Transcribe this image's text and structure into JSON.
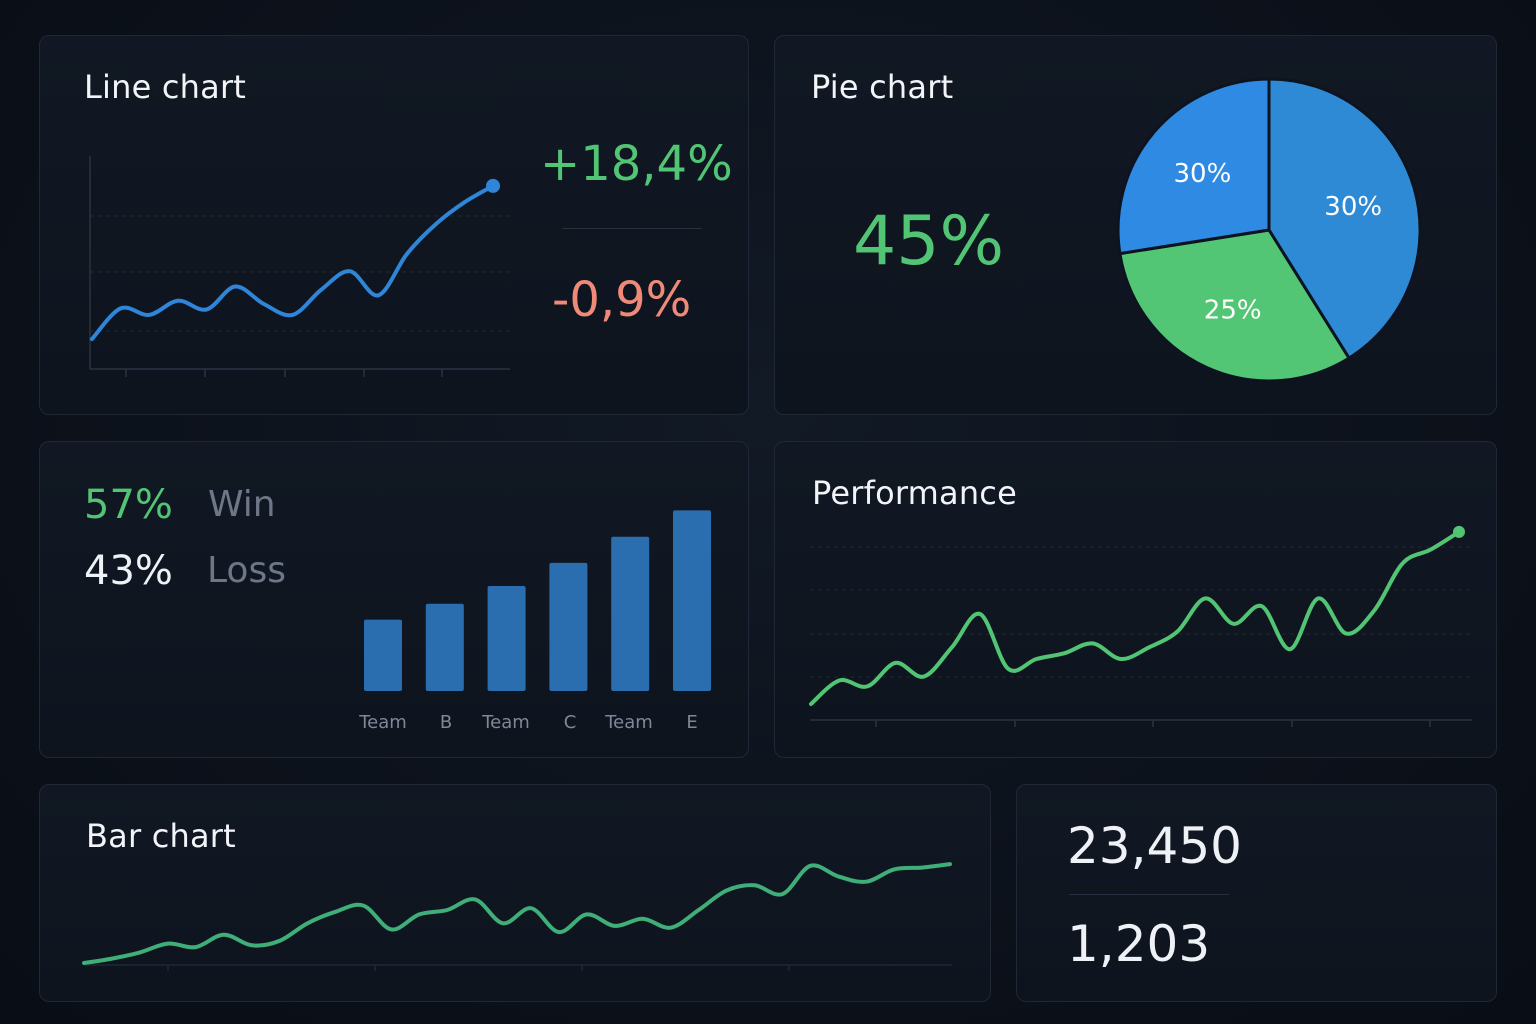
{
  "colors": {
    "blue": "#2f86d8",
    "green": "#52c575",
    "red": "#f08a78",
    "bar": "#2a6eb0",
    "pie_blue_a": "#2e8ae3",
    "pie_blue_b": "#2f8ad6",
    "pie_green": "#52c675"
  },
  "line_card": {
    "title": "Line chart",
    "up_value": "+18,4%",
    "down_value": "-0,9%"
  },
  "pie_card": {
    "title": "Pie chart",
    "big_value": "45%"
  },
  "winloss_card": {
    "win_value": "57%",
    "win_label": "Win",
    "loss_value": "43%",
    "loss_label": "Loss"
  },
  "performance_card": {
    "title": "Performance"
  },
  "bar_card": {
    "title": "Bar chart"
  },
  "stats_card": {
    "primary": "23,450",
    "secondary": "1,203"
  },
  "chart_data": [
    {
      "type": "line",
      "y": [
        0,
        28,
        22,
        35,
        27,
        48,
        32,
        22,
        45,
        62,
        40,
        78,
        105,
        125,
        140
      ],
      "ylim": [
        0,
        160
      ],
      "grid": true
    },
    {
      "type": "pie",
      "labels": [
        "30%",
        "30%",
        "25%"
      ],
      "values": [
        30,
        30,
        25
      ],
      "colors": [
        "#2e8ae3",
        "#2f8ad6",
        "#52c675"
      ]
    },
    {
      "type": "bar",
      "categories": [
        "Team",
        "B",
        "Team",
        "C",
        "Team",
        "E"
      ],
      "values": [
        68,
        83,
        100,
        122,
        147,
        172
      ],
      "ylim": [
        0,
        180
      ]
    },
    {
      "type": "line",
      "y": [
        0,
        24,
        18,
        42,
        28,
        58,
        92,
        36,
        46,
        52,
        62,
        46,
        58,
        74,
        108,
        82,
        100,
        56,
        108,
        72,
        96,
        144,
        158,
        176
      ],
      "ylim": [
        0,
        180
      ],
      "grid": true
    },
    {
      "type": "line",
      "y": [
        0,
        5,
        12,
        22,
        18,
        32,
        20,
        25,
        45,
        58,
        65,
        38,
        55,
        60,
        72,
        45,
        62,
        35,
        55,
        42,
        50,
        40,
        60,
        82,
        88,
        78,
        110,
        98,
        92,
        106,
        108,
        112
      ],
      "ylim": [
        0,
        120
      ],
      "grid": false
    }
  ]
}
